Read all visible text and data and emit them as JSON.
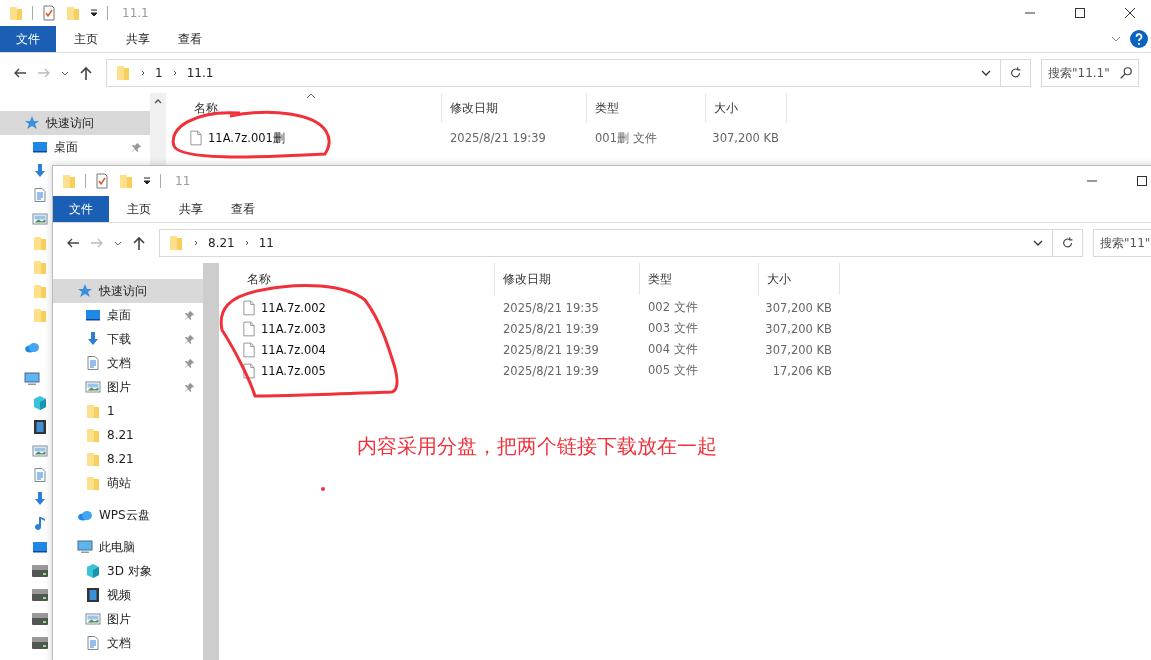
{
  "back_window": {
    "title": "11.1",
    "ribbon_tabs": [
      {
        "label": "文件",
        "kind": "file"
      },
      {
        "label": "主页",
        "kind": "tab"
      },
      {
        "label": "共享",
        "kind": "tab"
      },
      {
        "label": "查看",
        "kind": "tab"
      }
    ],
    "breadcrumb": [
      "1",
      "11.1"
    ],
    "search": {
      "placeholder": "搜索\"11.1\""
    },
    "nav": [
      {
        "label": "快速访问",
        "kind": "star",
        "selected": true,
        "children": [
          {
            "label": "桌面",
            "kind": "desktop",
            "pinned": true
          },
          {
            "kind": "download"
          },
          {
            "kind": "document"
          },
          {
            "kind": "picture"
          },
          {
            "kind": "folder"
          },
          {
            "kind": "folder"
          },
          {
            "kind": "folder"
          },
          {
            "kind": "folder"
          }
        ]
      },
      {
        "kind": "cloud",
        "selected": false
      },
      {
        "kind": "pc",
        "selected": false,
        "children": [
          {
            "kind": "cube"
          },
          {
            "kind": "video"
          },
          {
            "kind": "picture"
          },
          {
            "kind": "document"
          },
          {
            "kind": "download"
          },
          {
            "kind": "music"
          },
          {
            "kind": "desktop"
          },
          {
            "kind": "drive"
          },
          {
            "kind": "drive"
          },
          {
            "kind": "drive"
          },
          {
            "kind": "drive"
          }
        ]
      }
    ],
    "columns": [
      "名称",
      "修改日期",
      "类型",
      "大小"
    ],
    "files": [
      {
        "name": "11A.7z.001删",
        "date": "2025/8/21 19:39",
        "type": "001删 文件",
        "size": "307,200 KB"
      }
    ]
  },
  "front_window": {
    "title": "11",
    "ribbon_tabs": [
      {
        "label": "文件",
        "kind": "file"
      },
      {
        "label": "主页",
        "kind": "tab"
      },
      {
        "label": "共享",
        "kind": "tab"
      },
      {
        "label": "查看",
        "kind": "tab"
      }
    ],
    "breadcrumb": [
      "8.21",
      "11"
    ],
    "search": {
      "placeholder": "搜索\"11\""
    },
    "nav": [
      {
        "label": "快速访问",
        "kind": "star",
        "selected": true,
        "children": [
          {
            "label": "桌面",
            "kind": "desktop",
            "pinned": true
          },
          {
            "label": "下载",
            "kind": "download",
            "pinned": true
          },
          {
            "label": "文档",
            "kind": "document",
            "pinned": true
          },
          {
            "label": "图片",
            "kind": "picture",
            "pinned": true
          },
          {
            "label": "1",
            "kind": "folder",
            "pinned": false
          },
          {
            "label": "8.21",
            "kind": "folder",
            "pinned": false
          },
          {
            "label": "8.21",
            "kind": "folder",
            "pinned": false
          },
          {
            "label": "萌站",
            "kind": "folder",
            "pinned": false
          }
        ]
      },
      {
        "label": "WPS云盘",
        "kind": "cloud",
        "selected": false
      },
      {
        "label": "此电脑",
        "kind": "pc",
        "selected": false,
        "children": [
          {
            "label": "3D 对象",
            "kind": "cube"
          },
          {
            "label": "视频",
            "kind": "video"
          },
          {
            "label": "图片",
            "kind": "picture"
          },
          {
            "label": "文档",
            "kind": "document"
          }
        ]
      }
    ],
    "columns": [
      "名称",
      "修改日期",
      "类型",
      "大小"
    ],
    "files": [
      {
        "name": "11A.7z.002",
        "date": "2025/8/21 19:35",
        "type": "002 文件",
        "size": "307,200 KB"
      },
      {
        "name": "11A.7z.003",
        "date": "2025/8/21 19:39",
        "type": "003 文件",
        "size": "307,200 KB"
      },
      {
        "name": "11A.7z.004",
        "date": "2025/8/21 19:39",
        "type": "004 文件",
        "size": "307,200 KB"
      },
      {
        "name": "11A.7z.005",
        "date": "2025/8/21 19:39",
        "type": "005 文件",
        "size": "17,206 KB"
      }
    ]
  },
  "annotation": {
    "note": "内容采用分盘，把两个链接下载放在一起"
  }
}
